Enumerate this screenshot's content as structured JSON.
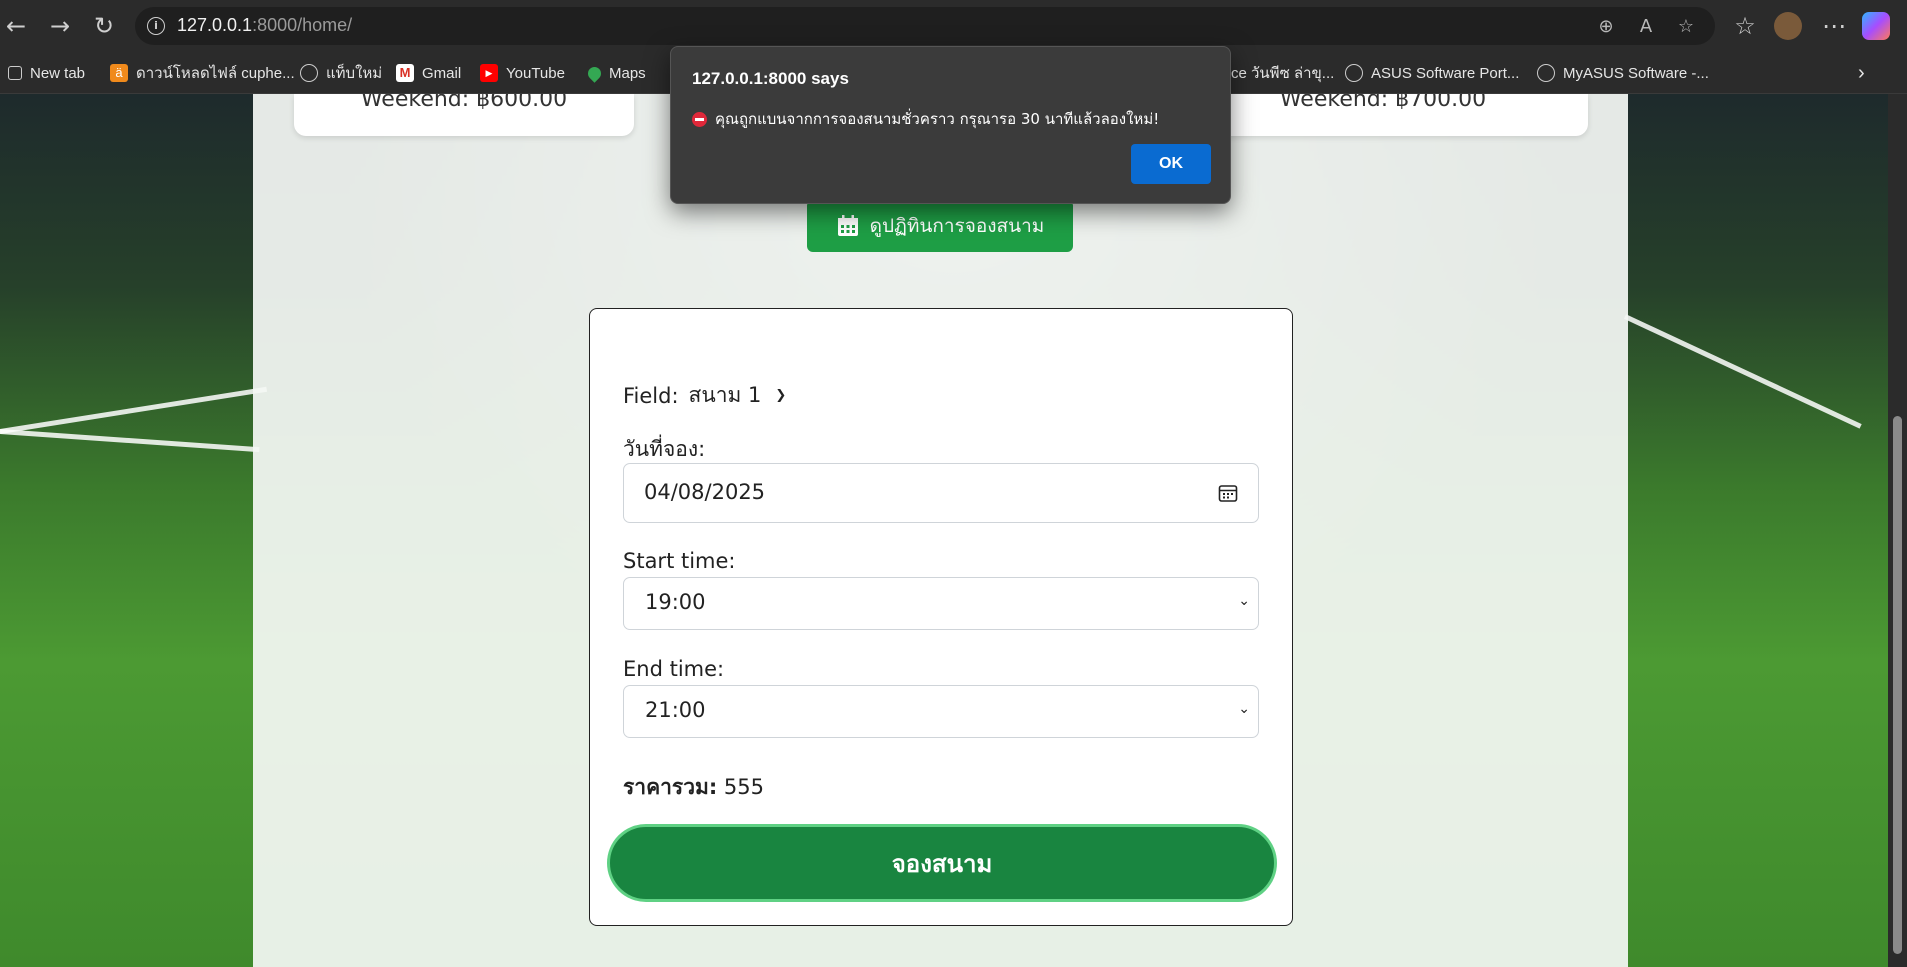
{
  "browser": {
    "url_host": "127.0.0.1",
    "url_rest": ":8000/home/",
    "bookmarks": [
      {
        "label": "New tab",
        "icon": "page-icon"
      },
      {
        "label": "ดาวน์โหลดไฟล์ cuphe...",
        "icon": "download-site-icon"
      },
      {
        "label": "แท็บใหม่",
        "icon": "globe-icon"
      },
      {
        "label": "Gmail",
        "icon": "gmail-icon"
      },
      {
        "label": "YouTube",
        "icon": "youtube-icon"
      },
      {
        "label": "Maps",
        "icon": "maps-pin-icon"
      },
      {
        "label": "ce วันพีซ ล่าขุ...",
        "icon": "none"
      },
      {
        "label": "ASUS Software Port...",
        "icon": "globe-icon"
      },
      {
        "label": "MyASUS Software -...",
        "icon": "globe-icon"
      }
    ]
  },
  "prices": {
    "left_weekend": "Weekend: ฿600.00",
    "right_weekend": "Weekend: ฿700.00"
  },
  "calendar_button_label": "ดูปฏิทินการจองสนาม",
  "form": {
    "field_label": "Field:",
    "field_value": "สนาม 1",
    "date_label": "วันที่จอง:",
    "date_value": "04/08/2025",
    "start_label": "Start time:",
    "start_value": "19:00",
    "end_label": "End time:",
    "end_value": "21:00",
    "total_label": "ราคารวม:",
    "total_value": "555",
    "submit_label": "จองสนาม"
  },
  "alert": {
    "title": "127.0.0.1:8000 says",
    "message": "คุณถูกแบนจากการจองสนามชั่วคราว กรุณารอ 30 นาทีแล้วลองใหม่!",
    "ok_label": "OK"
  },
  "colors": {
    "primary_green": "#1e9e45",
    "submit_green": "#198540",
    "ok_blue": "#0a6bd1"
  }
}
